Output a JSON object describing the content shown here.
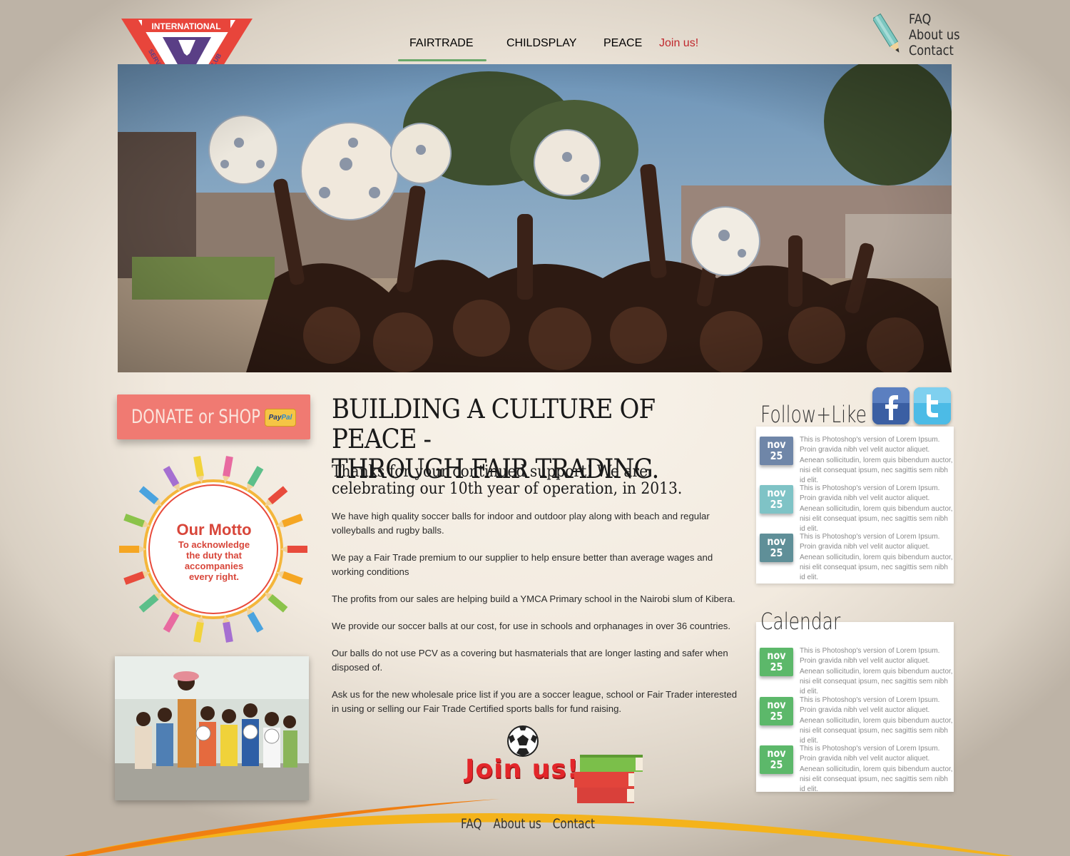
{
  "logo": {
    "text_top": "INTERNATIONAL",
    "text_left": "SERVICE",
    "text_right": "CLUB"
  },
  "nav": {
    "items": [
      "FAIRTRADE",
      "CHILDSPLAY",
      "PEACE"
    ],
    "join": "Join us!"
  },
  "util_links": [
    "FAQ",
    "About us",
    "Contact"
  ],
  "donate": {
    "label": "DONATE or SHOP",
    "paypal_a": "Pay",
    "paypal_b": "Pal"
  },
  "motto": {
    "title": "Our Motto",
    "lines": [
      "To acknowledge",
      "the duty that",
      "accompanies",
      "every right."
    ]
  },
  "headline": [
    "BUILDING A CULTURE OF PEACE -",
    "THROUGH FAIR TRADING."
  ],
  "subhead": "Thanks for your continued support!   We are celebrating our 10th year of operation, in 2013.",
  "body": [
    "We have high quality soccer balls for indoor and outdoor play along with beach and regular volleyballs and rugby balls.",
    "We pay a Fair Trade premium to our supplier to help ensure better than average wages and working conditions",
    "The profits from our sales are helping build a YMCA Primary school in the Nairobi slum of Kibera.",
    "We provide our soccer balls at our cost, for use in schools and orphanages in over 36 countries.",
    "Our balls do not use PCV as a  covering but hasmaterials that are longer lasting and safer when disposed of.",
    "Ask us for the new wholesale price list if you are a soccer league, school or Fair Trader interested in using or selling our Fair Trade Certified sports balls for fund raising."
  ],
  "join_cta": "Join us!",
  "footer": [
    "FAQ",
    "About us",
    "Contact"
  ],
  "follow": {
    "title": "Follow+Like",
    "events": [
      {
        "month": "nov",
        "day": "25",
        "text": "This is Photoshop's version  of Lorem Ipsum. Proin gravida nibh vel velit auctor aliquet. Aenean sollicitudin, lorem quis bibendum auctor, nisi elit consequat ipsum, nec sagittis sem nibh id elit."
      },
      {
        "month": "nov",
        "day": "25",
        "text": "This is Photoshop's version  of Lorem Ipsum. Proin gravida nibh vel velit auctor aliquet. Aenean sollicitudin, lorem quis bibendum auctor, nisi elit consequat ipsum, nec sagittis sem nibh id elit."
      },
      {
        "month": "nov",
        "day": "25",
        "text": "This is Photoshop's version  of Lorem Ipsum. Proin gravida nibh vel velit auctor aliquet. Aenean sollicitudin, lorem quis bibendum auctor, nisi elit consequat ipsum, nec sagittis sem nibh id elit."
      }
    ]
  },
  "calendar": {
    "title": "Calendar",
    "events": [
      {
        "month": "nov",
        "day": "25",
        "text": "This is Photoshop's version  of Lorem Ipsum. Proin gravida nibh vel velit auctor aliquet. Aenean sollicitudin, lorem quis bibendum auctor, nisi elit consequat ipsum, nec sagittis sem nibh id elit."
      },
      {
        "month": "nov",
        "day": "25",
        "text": "This is Photoshop's version  of Lorem Ipsum. Proin gravida nibh vel velit auctor aliquet. Aenean sollicitudin, lorem quis bibendum auctor, nisi elit consequat ipsum, nec sagittis sem nibh id elit."
      },
      {
        "month": "nov",
        "day": "25",
        "text": "This is Photoshop's version  of Lorem Ipsum. Proin gravida nibh vel velit auctor aliquet. Aenean sollicitudin, lorem quis bibendum auctor, nisi elit consequat ipsum, nec sagittis sem nibh id elit."
      }
    ]
  },
  "colors": {
    "accent_red": "#e3262a",
    "nav_underline": "#6aa86a",
    "donate_bg": "#f07a72",
    "badge_blue": "#6f86a8",
    "badge_teal": "#7fc3c6",
    "badge_slate": "#5f8f98",
    "badge_green": "#5cb86a"
  }
}
